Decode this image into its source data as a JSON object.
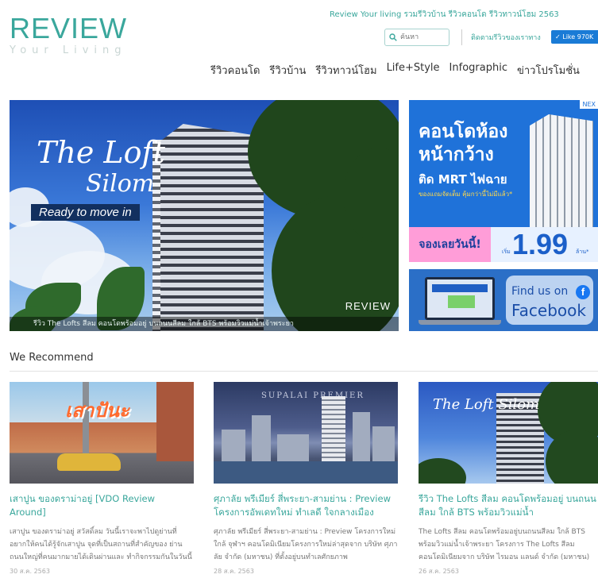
{
  "header": {
    "logo_main": "REVIEW",
    "logo_sub": "Your Living",
    "tagline": "Review Your living รวมรีวิวบ้าน รีวิวคอนโด รีวิวทาวน์โฮม 2563",
    "search_placeholder": "ค้นหา",
    "follow_text": "ติดตามรีวิวของเราทาง",
    "like_label": "✓ Like 970K"
  },
  "nav": {
    "items": [
      "รีวิวคอนโด",
      "รีวิวบ้าน",
      "รีวิวทาวน์โฮม",
      "Life+Style",
      "Infographic",
      "ข่าวโปรโมชั่น"
    ]
  },
  "hero": {
    "title_line1": "The Loft",
    "title_line2": "Silom",
    "badge": "Ready to move in",
    "logo": "REVIEW",
    "caption": "รีวิว The Lofts สีลม คอนโดพร้อมอยู่ บนถนนสีลม ใกล้ BTS พร้อมวิวแม่น้ำเจ้าพระยา"
  },
  "ad_condo": {
    "title_line1": "คอนโดห้อง",
    "title_line2": "หน้ากว้าง",
    "subtitle": "ติด MRT ไฟฉาย",
    "note": "ของแถมจัดเต็ม คุ้มกว่านี้ไม่มีแล้ว*",
    "book_label": "จองเลยวันนี้!",
    "price_prefix": "เริ่ม",
    "price": "1.99",
    "price_unit": "ล้าน*",
    "next_label": "NEX"
  },
  "ad_facebook": {
    "find_text": "Find us on",
    "name": "Facebook",
    "icon": "f"
  },
  "recommend": {
    "title": "We Recommend",
    "cards": [
      {
        "image_text": "เสาปันะ",
        "title": "เสาปูน ของดราม่าอยู่ [VDO Review Around]",
        "excerpt": "เสาปูน ของดราม่าอยู่ สวัสดิ์ลม วันนี้เราจะพาไปดูย่านที่ อยากให้คนได้รู้จักเสาปูน จุดที่เป็นสถานที่สำคัญของ ย่านถนนใหญ่ที่คนมากมายได้เดินผ่านและ ทำกิจกรรมกันในวันนี้",
        "date": "30 ส.ค. 2563"
      },
      {
        "image_text": "SUPALAI PREMIER",
        "title": "ศุภาลัย พรีเมียร์ สี่พระยา-สามย่าน : Preview โครงการอัพเดทใหม่ ทำเลดี ใจกลางเมือง",
        "excerpt": "ศุภาลัย พรีเมียร์ สี่พระยา-สามย่าน : Preview โครงการใหม่ใกล้ จุฬาฯ คอนโดมิเนียมโครงการใหม่ล่าสุดจาก บริษัท ศุภาลัย จำกัด (มหาชน) ที่ตั้งอยู่บนทำเลศักยภาพ",
        "date": "28 ส.ค. 2563"
      },
      {
        "image_text": "The Loft Silom",
        "title": "รีวิว The Lofts สีลม คอนโดพร้อมอยู่ บนถนนสีลม ใกล้ BTS พร้อมวิวแม่น้ำ",
        "excerpt": "The Lofts สีลม คอนโดพร้อมอยู่บนถนนสีลม ใกล้ BTS พร้อมวิวแม่น้ำเจ้าพระยา โครงการ The Lofts สีลม คอนโดมิเนียมจาก บริษัท ไรมอน แลนด์ จำกัด (มหาชน)",
        "date": "26 ส.ค. 2563"
      }
    ]
  },
  "colors": {
    "brand": "#3aa79c",
    "like_button": "#1a7bd6",
    "ad_blue": "#1f72d9",
    "ad_pink": "#ff9dd8"
  }
}
